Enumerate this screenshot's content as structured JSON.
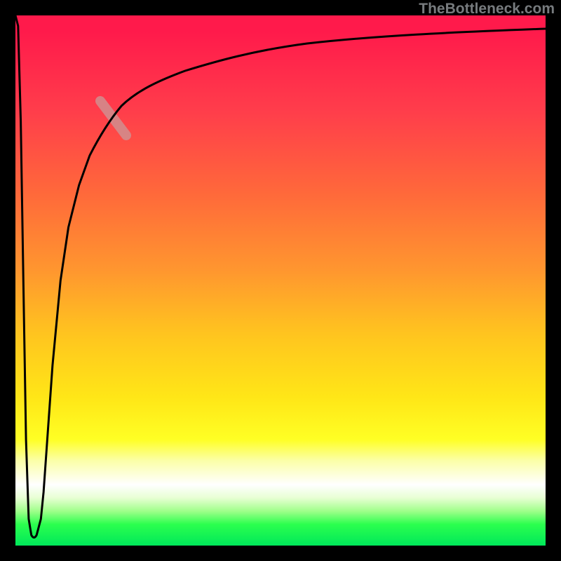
{
  "attribution": "TheBottleneck.com",
  "colors": {
    "frame": "#000000",
    "gradient_top": "#ff1a4b",
    "gradient_bottom": "#00e85a",
    "curve": "#000000",
    "highlight": "#cf9292"
  },
  "chart_data": {
    "type": "line",
    "title": "",
    "xlabel": "",
    "ylabel": "",
    "xlim": [
      0,
      100
    ],
    "ylim": [
      0,
      100
    ],
    "grid": false,
    "legend": false,
    "series": [
      {
        "name": "bottleneck-curve",
        "x": [
          0.0,
          0.5,
          1.0,
          1.5,
          2.0,
          2.5,
          3.0,
          3.5,
          4.0,
          4.8,
          5.3,
          6.0,
          7.0,
          8.5,
          10.0,
          12.0,
          14.0,
          16.0,
          18.0,
          20.0,
          23.0,
          27.0,
          32.0,
          38.0,
          45.0,
          55.0,
          68.0,
          82.0,
          100.0
        ],
        "y": [
          100.0,
          98.0,
          80.0,
          50.0,
          20.0,
          5.0,
          2.0,
          1.0,
          2.0,
          5.0,
          10.0,
          20.0,
          34.0,
          50.0,
          60.0,
          68.0,
          73.5,
          77.5,
          80.5,
          83.0,
          85.5,
          87.7,
          89.5,
          91.0,
          92.2,
          93.3,
          94.2,
          94.8,
          95.4
        ]
      }
    ],
    "annotations": [
      {
        "name": "highlight-segment",
        "x_range": [
          16.0,
          20.8
        ],
        "y_range": [
          77.5,
          83.6
        ]
      }
    ]
  }
}
